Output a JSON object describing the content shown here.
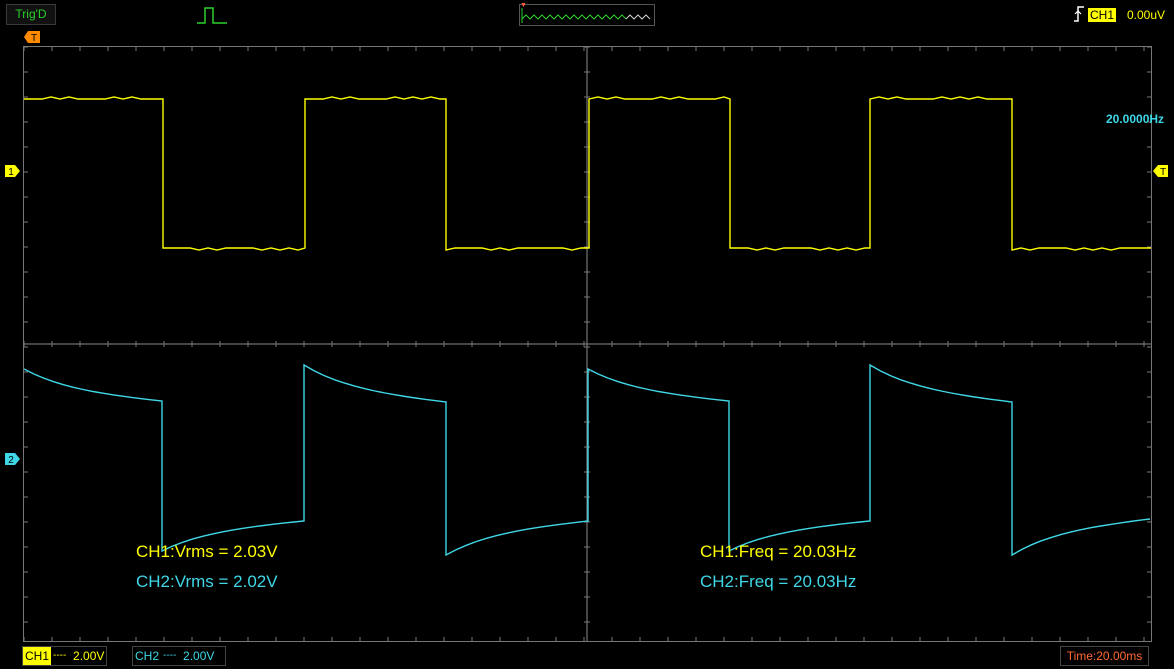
{
  "topbar": {
    "trigger_status": "Trig'D",
    "trigger_source": "CH1",
    "trigger_level": "0.00uV",
    "pulse_icon": "rising-pulse-icon",
    "edge_icon": "rising-edge-icon"
  },
  "markers": {
    "trigger_position": "T",
    "ch1": "1",
    "ch2": "2",
    "trigger_level_right": "T"
  },
  "colors": {
    "ch1": "#ffff00",
    "ch2": "#3fd7e6",
    "grid": "#5a5a5a",
    "trigger": "#ff6a36",
    "status_green": "#2bd12b"
  },
  "display": {
    "frequency_readout": "20.0000Hz"
  },
  "measurements": {
    "ch1_vrms": "CH1:Vrms = 2.03V",
    "ch2_vrms": "CH2:Vrms = 2.02V",
    "ch1_freq": "CH1:Freq = 20.03Hz",
    "ch2_freq": "CH2:Freq = 20.03Hz"
  },
  "bottombar": {
    "ch1_label": "CH1",
    "ch1_coupling": "----",
    "ch1_scale": "2.00V",
    "ch2_label": "CH2",
    "ch2_coupling": "----",
    "ch2_scale": "2.00V",
    "timebase": "Time:20.00ms"
  }
}
